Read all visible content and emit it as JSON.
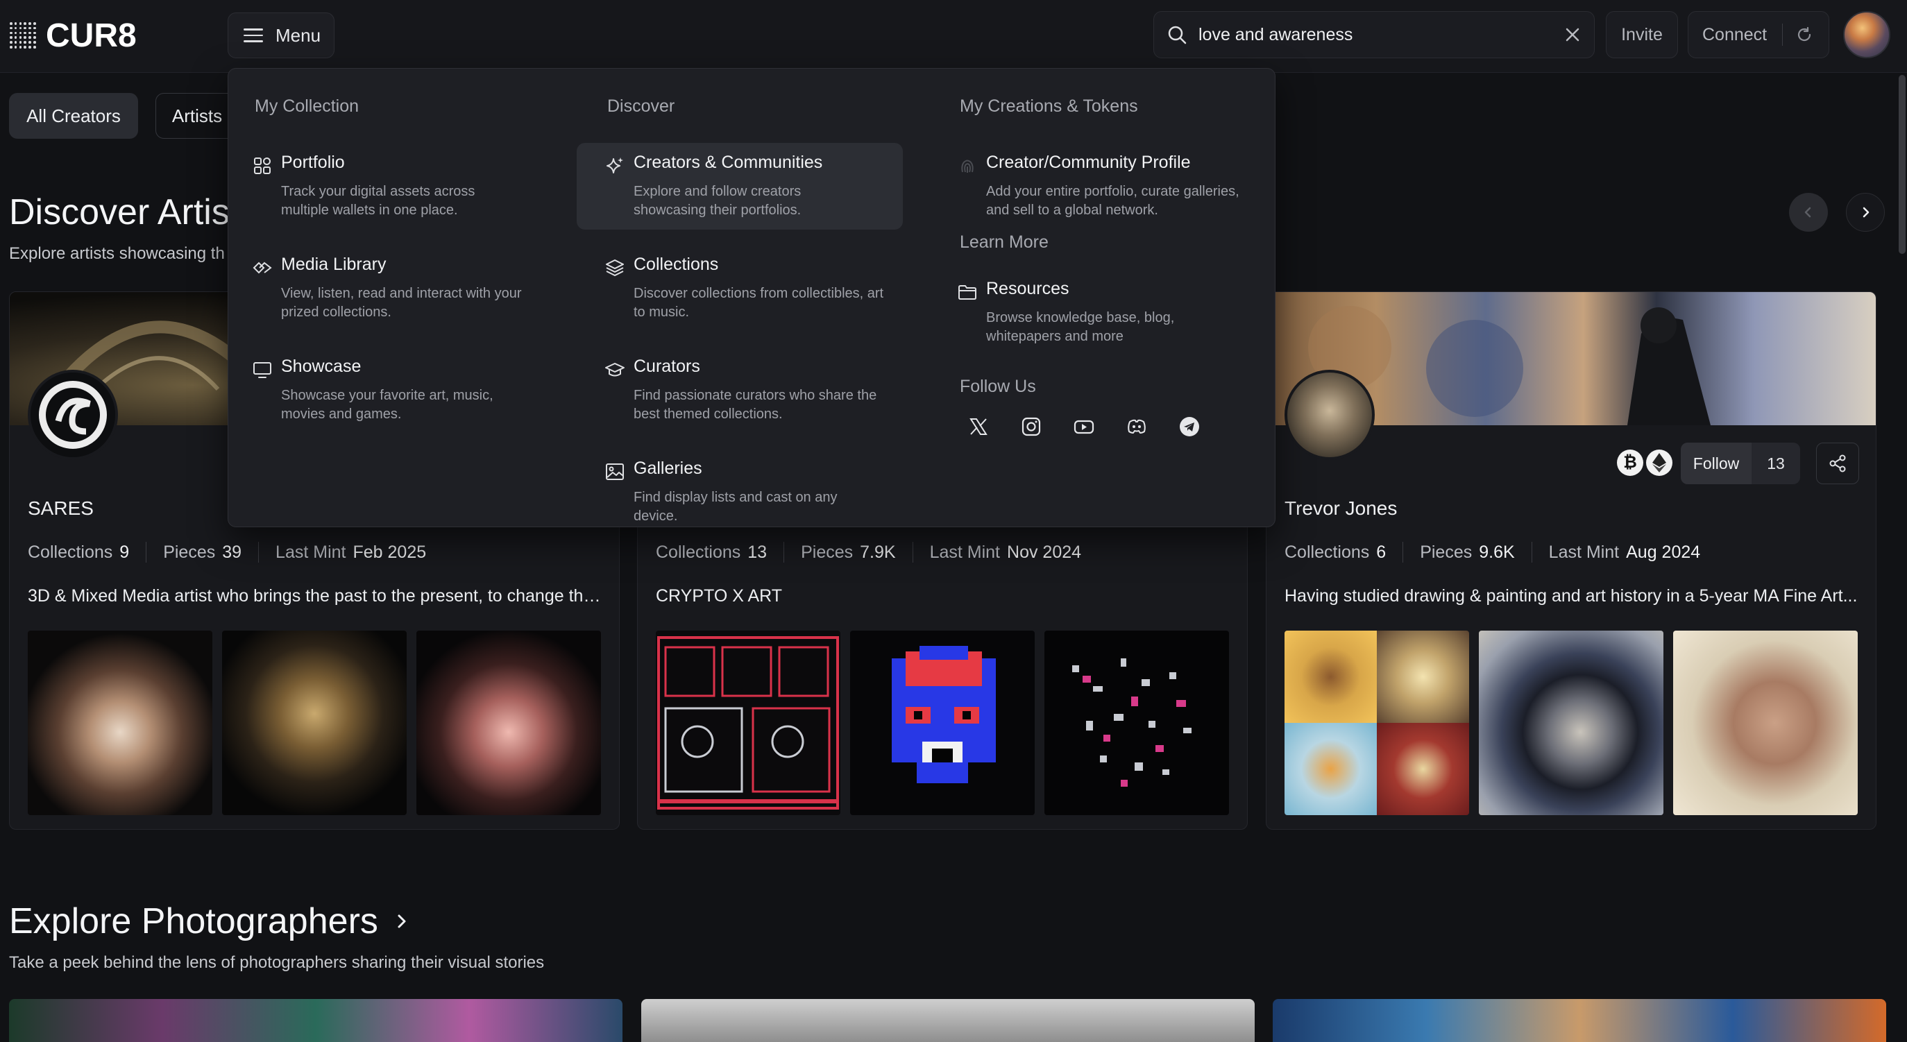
{
  "header": {
    "logo_text": "CUR8",
    "menu_label": "Menu",
    "search_value": "love and awareness",
    "invite_label": "Invite",
    "connect_label": "Connect"
  },
  "filters": {
    "active": "All Creators",
    "second": "Artists"
  },
  "artists_section": {
    "title": "Discover Artis",
    "subtitle": "Explore artists showcasing th"
  },
  "cards": [
    {
      "name": "SARES",
      "stats": [
        {
          "k": "Collections",
          "v": "9"
        },
        {
          "k": "Pieces",
          "v": "39"
        },
        {
          "k": "Last Mint",
          "v": "Feb 2025"
        }
      ],
      "desc": "3D & Mixed Media artist who brings the past to the present, to change the..."
    },
    {
      "name": "",
      "stats": [
        {
          "k": "Collections",
          "v": "13"
        },
        {
          "k": "Pieces",
          "v": "7.9K"
        },
        {
          "k": "Last Mint",
          "v": "Nov 2024"
        }
      ],
      "desc": "CRYPTO X ART"
    },
    {
      "name": "Trevor Jones",
      "stats": [
        {
          "k": "Collections",
          "v": "6"
        },
        {
          "k": "Pieces",
          "v": "9.6K"
        },
        {
          "k": "Last Mint",
          "v": "Aug 2024"
        }
      ],
      "desc": "Having studied drawing & painting and art history in a 5-year MA Fine Art...",
      "follow_label": "Follow",
      "follow_count": "13",
      "chains": [
        "bitcoin-icon",
        "ethereum-icon"
      ]
    }
  ],
  "photographers_section": {
    "title": "Explore Photographers",
    "subtitle": "Take a peek behind the lens of photographers sharing their visual stories"
  },
  "dropdown": {
    "col1": {
      "heading": "My Collection",
      "items": [
        {
          "title": "Portfolio",
          "desc": "Track your digital assets across multiple wallets in one place."
        },
        {
          "title": "Media Library",
          "desc": "View, listen, read and interact with your prized collections."
        },
        {
          "title": "Showcase",
          "desc": "Showcase your favorite art, music, movies and games."
        }
      ]
    },
    "col2": {
      "heading": "Discover",
      "items": [
        {
          "title": "Creators & Communities",
          "desc": "Explore and follow creators showcasing their portfolios."
        },
        {
          "title": "Collections",
          "desc": "Discover collections from collectibles, art to music."
        },
        {
          "title": "Curators",
          "desc": "Find passionate curators who share the best themed collections."
        },
        {
          "title": "Galleries",
          "desc": "Find display lists and cast on any device."
        }
      ]
    },
    "col3": {
      "heading": "My Creations & Tokens",
      "items": [
        {
          "title": "Creator/Community Profile",
          "desc": "Add your entire portfolio, curate galleries, and sell to a global network."
        }
      ],
      "learn_heading": "Learn More",
      "learn_items": [
        {
          "title": "Resources",
          "desc": "Browse knowledge base, blog, whitepapers and more"
        }
      ],
      "follow_heading": "Follow Us",
      "socials": [
        "x-icon",
        "instagram-icon",
        "youtube-icon",
        "discord-icon",
        "telegram-icon"
      ]
    }
  },
  "colors": {
    "background": "#111215",
    "panel": "#1e1f24",
    "highlight": "#2c2e34",
    "text": "#e8e9ec",
    "muted": "#9fa1a8"
  }
}
